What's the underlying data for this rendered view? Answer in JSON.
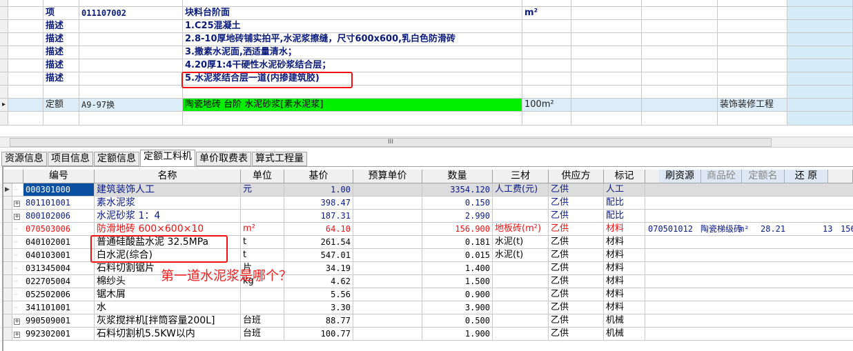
{
  "top_grid": {
    "rows": [
      {
        "type": "项",
        "code": "011107002",
        "name": "块料台阶面",
        "unit": "m²",
        "extra": ""
      },
      {
        "type": "描述",
        "code": "",
        "name": "1.C25混凝土",
        "unit": "",
        "extra": ""
      },
      {
        "type": "描述",
        "code": "",
        "name": "2.8-10厚地砖铺实拍平,水泥浆擦缝，尺寸600x600,乳白色防滑砖",
        "unit": "",
        "extra": ""
      },
      {
        "type": "描述",
        "code": "",
        "name": "3.撒素水泥面,洒适量清水；",
        "unit": "",
        "extra": ""
      },
      {
        "type": "描述",
        "code": "",
        "name": "4.20厚1:4干硬性水泥砂浆结合层；",
        "unit": "",
        "extra": ""
      },
      {
        "type": "描述",
        "code": "",
        "name": "5.水泥浆结合层一道(内掺建筑胶)",
        "unit": "",
        "extra": ""
      },
      {
        "type": "",
        "code": "",
        "name": "",
        "unit": "",
        "extra": ""
      },
      {
        "type": "定额",
        "code": "A9-97换",
        "name": "陶瓷地砖 台阶 水泥砂浆[素水泥浆]",
        "unit": "100m²",
        "extra": "装饰装修工程"
      }
    ]
  },
  "scrollbar_grip": "III",
  "tabs": [
    "资源信息",
    "项目信息",
    "定额信息",
    "定额工料机",
    "单价取费表",
    "算式工程量"
  ],
  "active_tab": 3,
  "table": {
    "headers": [
      "编号",
      "名称",
      "单位",
      "基价",
      "预算单价",
      "数量",
      "三材",
      "供应方",
      "标记"
    ],
    "buttons": [
      "刷资源",
      "商品砼",
      "定额名",
      "还 原"
    ],
    "rows": [
      {
        "code": "000301000",
        "name": "建筑装饰人工",
        "unit": "元",
        "price": "1.00",
        "budget": "",
        "qty": "3354.120",
        "sancai": "人工费(元)",
        "supplier": "乙供",
        "mark": "人工",
        "color": "#0a1a8a",
        "exp": false
      },
      {
        "code": "801101001",
        "name": "素水泥浆",
        "unit": "",
        "price": "398.47",
        "budget": "",
        "qty": "0.150",
        "sancai": "",
        "supplier": "乙供",
        "mark": "配比",
        "color": "#0a1a8a",
        "exp": true
      },
      {
        "code": "800102006",
        "name": "水泥砂浆 1：4",
        "unit": "",
        "price": "187.31",
        "budget": "",
        "qty": "2.990",
        "sancai": "",
        "supplier": "乙供",
        "mark": "配比",
        "color": "#0a1a8a",
        "exp": true
      },
      {
        "code": "070503006",
        "name": "防滑地砖 600×600×10",
        "unit": "m²",
        "price": "64.10",
        "budget": "",
        "qty": "156.900",
        "sancai": "地板砖(m²)",
        "supplier": "乙供",
        "mark": "材料",
        "color": "#f01010",
        "exp": false
      },
      {
        "code": "040102001",
        "name": "普通硅酸盐水泥 32.5MPa",
        "unit": "t",
        "price": "261.54",
        "budget": "",
        "qty": "0.181",
        "sancai": "水泥(t)",
        "supplier": "乙供",
        "mark": "材料",
        "color": "#000",
        "exp": false
      },
      {
        "code": "040103001",
        "name": "白水泥(综合)",
        "unit": "t",
        "price": "547.01",
        "budget": "",
        "qty": "0.015",
        "sancai": "水泥(t)",
        "supplier": "乙供",
        "mark": "材料",
        "color": "#000",
        "exp": false
      },
      {
        "code": "031345004",
        "name": "石料切割锯片",
        "unit": "片",
        "price": "34.19",
        "budget": "",
        "qty": "1.400",
        "sancai": "",
        "supplier": "乙供",
        "mark": "材料",
        "color": "#000",
        "exp": false
      },
      {
        "code": "022705004",
        "name": "棉纱头",
        "unit": "kg",
        "price": "4.62",
        "budget": "",
        "qty": "1.500",
        "sancai": "",
        "supplier": "乙供",
        "mark": "材料",
        "color": "#000",
        "exp": false
      },
      {
        "code": "052502006",
        "name": "锯木屑",
        "unit": "",
        "price": "5.56",
        "budget": "",
        "qty": "0.900",
        "sancai": "",
        "supplier": "乙供",
        "mark": "材料",
        "color": "#000",
        "exp": false
      },
      {
        "code": "341101001",
        "name": "水",
        "unit": "",
        "price": "3.30",
        "budget": "",
        "qty": "3.900",
        "sancai": "",
        "supplier": "乙供",
        "mark": "材料",
        "color": "#000",
        "exp": false
      },
      {
        "code": "990509001",
        "name": "灰浆搅拌机[拌筒容量200L]",
        "unit": "台班",
        "price": "88.77",
        "budget": "",
        "qty": "0.500",
        "sancai": "",
        "supplier": "乙供",
        "mark": "机械",
        "color": "#000",
        "exp": true
      },
      {
        "code": "992302001",
        "name": "石料切割机5.5KW以内",
        "unit": "台班",
        "price": "100.77",
        "budget": "",
        "qty": "1.900",
        "sancai": "",
        "supplier": "乙供",
        "mark": "机械",
        "color": "#000",
        "exp": true
      }
    ],
    "side_info": {
      "code": "070501012",
      "name": "陶瓷梯级砖",
      "unit": "m²",
      "price": "28.21",
      "n1": "13",
      "n2": "156"
    }
  },
  "annotation": "第一道水泥浆是哪个？"
}
